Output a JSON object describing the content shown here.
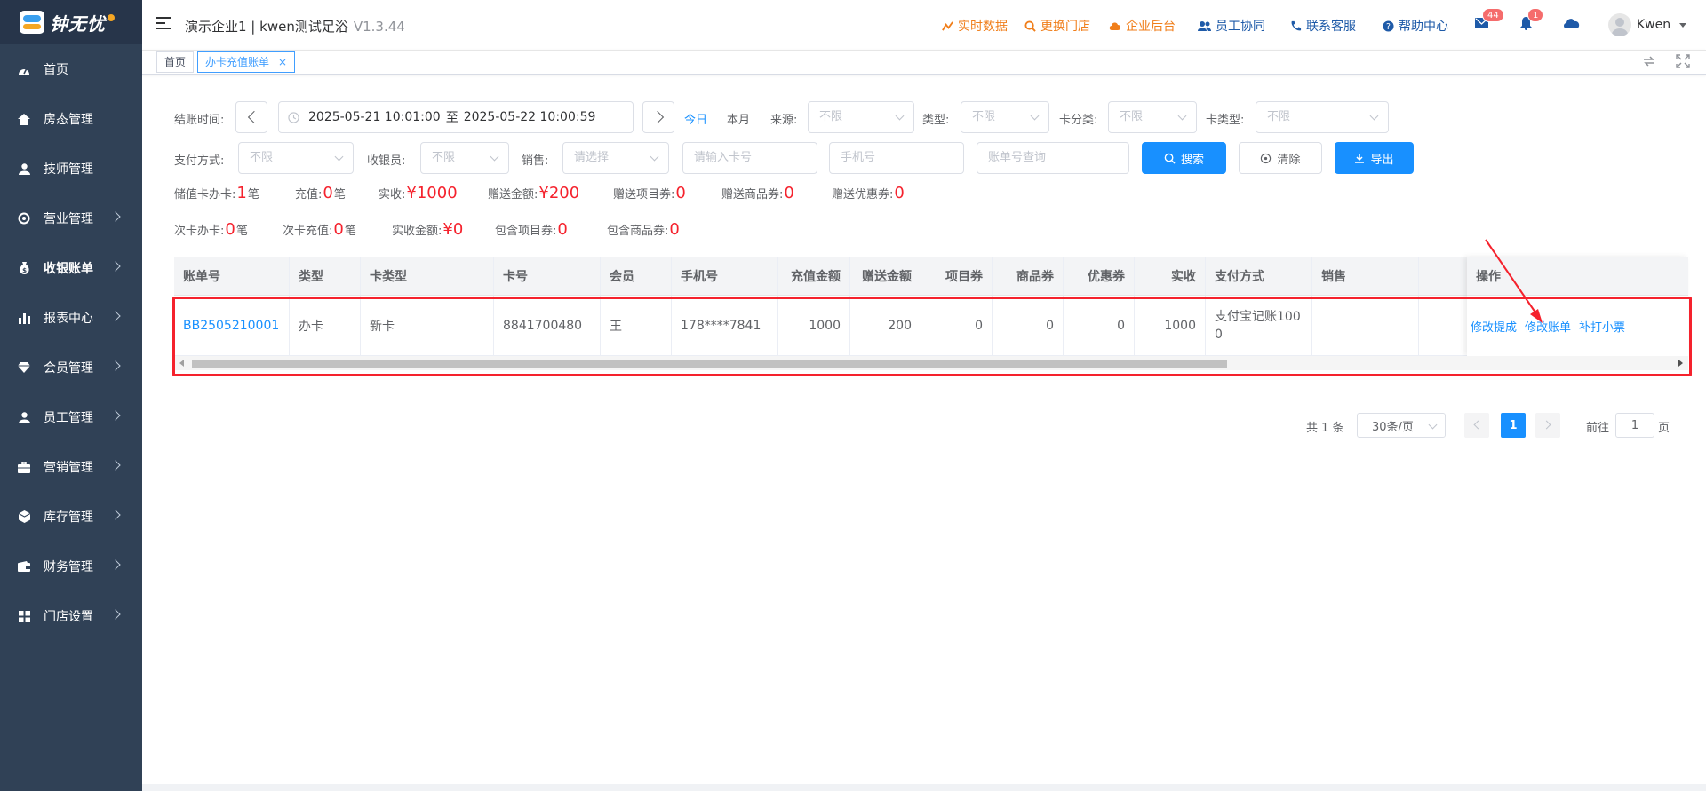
{
  "logo": {
    "text": "钟无忧"
  },
  "sidebar": {
    "items": [
      {
        "label": "首页",
        "icon": "dashboard-icon",
        "arrow": false
      },
      {
        "label": "房态管理",
        "icon": "home-icon",
        "arrow": false
      },
      {
        "label": "技师管理",
        "icon": "person-icon",
        "arrow": false
      },
      {
        "label": "营业管理",
        "icon": "compass-icon",
        "arrow": true
      },
      {
        "label": "收银账单",
        "icon": "money-bag-icon",
        "arrow": true,
        "active": true
      },
      {
        "label": "报表中心",
        "icon": "bar-chart-icon",
        "arrow": true
      },
      {
        "label": "会员管理",
        "icon": "diamond-icon",
        "arrow": true
      },
      {
        "label": "员工管理",
        "icon": "person-icon",
        "arrow": true
      },
      {
        "label": "营销管理",
        "icon": "briefcase-icon",
        "arrow": true
      },
      {
        "label": "库存管理",
        "icon": "cube-icon",
        "arrow": true
      },
      {
        "label": "财务管理",
        "icon": "wallet-icon",
        "arrow": true
      },
      {
        "label": "门店设置",
        "icon": "grid-icon",
        "arrow": true
      }
    ]
  },
  "header": {
    "title": "演示企业1 | kwen测试足浴",
    "version": "V1.3.44",
    "links": {
      "realtime": "实时数据",
      "switch_store": "更换门店",
      "enterprise": "企业后台",
      "staff_collab": "员工协同",
      "support": "联系客服",
      "help": "帮助中心"
    },
    "mail_badge": "44",
    "bell_badge": "1",
    "user_name": "Kwen"
  },
  "tags": {
    "home": "首页",
    "current": "办卡充值账单",
    "close": "×"
  },
  "filters": {
    "checkout_time_label": "结账时间:",
    "date_start": "2025-05-21 10:01:00",
    "date_sep": "至",
    "date_end": "2025-05-22 10:00:59",
    "today": "今日",
    "this_month": "本月",
    "source_label": "来源:",
    "source_value": "不限",
    "type_label": "类型:",
    "type_value": "不限",
    "card_category_label": "卡分类:",
    "card_category_value": "不限",
    "card_type_label": "卡类型:",
    "card_type_value": "不限",
    "payment_label": "支付方式:",
    "payment_value": "不限",
    "cashier_label": "收银员:",
    "cashier_value": "不限",
    "sales_label": "销售:",
    "sales_placeholder": "请选择",
    "card_no_placeholder": "请输入卡号",
    "phone_placeholder": "手机号",
    "bill_no_placeholder": "账单号查询",
    "search": "搜索",
    "clear": "清除",
    "export": "导出"
  },
  "stats": {
    "row1": [
      {
        "label": "储值卡办卡:",
        "value": "1",
        "unit": "笔"
      },
      {
        "label": "充值:",
        "value": "0",
        "unit": "笔"
      },
      {
        "label": "实收:",
        "value": "¥1000",
        "unit": ""
      },
      {
        "label": "赠送金额:",
        "value": "¥200",
        "unit": ""
      },
      {
        "label": "赠送项目券:",
        "value": "0",
        "unit": ""
      },
      {
        "label": "赠送商品券:",
        "value": "0",
        "unit": ""
      },
      {
        "label": "赠送优惠券:",
        "value": "0",
        "unit": ""
      }
    ],
    "row2": [
      {
        "label": "次卡办卡:",
        "value": "0",
        "unit": "笔"
      },
      {
        "label": "次卡充值:",
        "value": "0",
        "unit": "笔"
      },
      {
        "label": "实收金额:",
        "value": "¥0",
        "unit": ""
      },
      {
        "label": "包含项目券:",
        "value": "0",
        "unit": ""
      },
      {
        "label": "包含商品券:",
        "value": "0",
        "unit": ""
      }
    ]
  },
  "table": {
    "headers": [
      "账单号",
      "类型",
      "卡类型",
      "卡号",
      "会员",
      "手机号",
      "充值金额",
      "赠送金额",
      "项目券",
      "商品券",
      "优惠券",
      "实收",
      "支付方式",
      "销售",
      ""
    ],
    "rows": [
      [
        "BB2505210001",
        "办卡",
        "新卡",
        "8841700480",
        "王",
        "178****7841",
        "1000",
        "200",
        "0",
        "0",
        "0",
        "1000",
        "支付宝记账1000",
        "",
        ""
      ]
    ],
    "ops_header": "操作",
    "ops": [
      "修改提成",
      "修改账单",
      "补打小票"
    ]
  },
  "pagination": {
    "total": "共 1 条",
    "page_size": "30条/页",
    "current": "1",
    "goto_label": "前往",
    "goto_value": "1",
    "page_suffix": "页"
  }
}
